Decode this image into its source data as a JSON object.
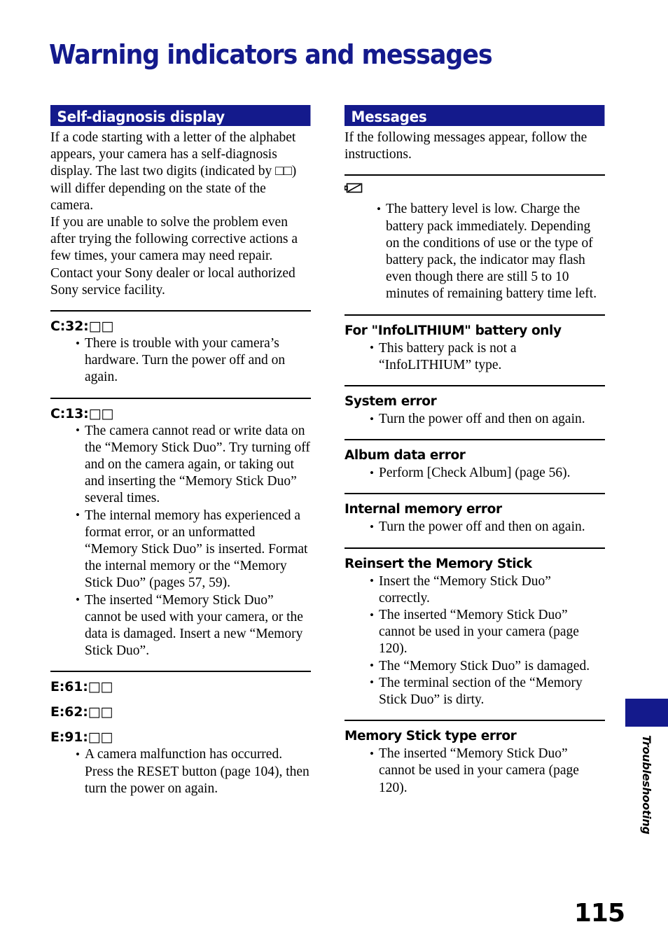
{
  "page": {
    "title": "Warning indicators and messages",
    "number": "115",
    "side_tab_label": "Troubleshooting",
    "accent_color": "#141a8c",
    "rule_color": "#000000"
  },
  "left_column": {
    "header": "Self-diagnosis display",
    "intro": [
      "If a code starting with a letter of the alphabet appears, your camera has a self-diagnosis display. The last two digits (indicated by □□) will differ depending on the state of the camera.",
      "If you are unable to solve the problem even after trying the following corrective actions a few times, your camera may need repair. Contact your Sony dealer or local authorized Sony service facility."
    ],
    "entries": [
      {
        "code": "C:32:□□",
        "bullets": [
          "There is trouble with your camera’s hardware. Turn the power off and on again."
        ]
      },
      {
        "code": "C:13:□□",
        "bullets": [
          "The camera cannot read or write data on the “Memory Stick Duo”. Try turning off and on the camera again, or taking out and inserting the “Memory Stick Duo” several times.",
          "The internal memory has experienced a format error, or an unformatted “Memory Stick Duo” is inserted. Format the internal memory or the “Memory Stick Duo” (pages 57, 59).",
          "The inserted “Memory Stick Duo” cannot be used with your camera, or the data is damaged. Insert a new “Memory Stick Duo”."
        ]
      },
      {
        "codes": [
          "E:61:□□",
          "E:62:□□",
          "E:91:□□"
        ],
        "bullets": [
          "A camera malfunction has occurred. Press the RESET button (page 104), then turn the power on again."
        ]
      }
    ]
  },
  "right_column": {
    "header": "Messages",
    "intro": [
      "If the following messages appear, follow the instructions."
    ],
    "entries": [
      {
        "icon": "low-battery-icon",
        "heading": "",
        "bullets": [
          "The battery level is low. Charge the battery pack immediately. Depending on the conditions of use or the type of battery pack, the indicator may flash even though there are still 5 to 10 minutes of remaining battery time left."
        ]
      },
      {
        "heading": "For \"InfoLITHIUM\" battery only",
        "bullets": [
          "This battery pack is not a “InfoLITHIUM” type."
        ]
      },
      {
        "heading": "System error",
        "bullets": [
          "Turn the power off and then on again."
        ]
      },
      {
        "heading": "Album data error",
        "bullets": [
          "Perform [Check Album] (page 56)."
        ]
      },
      {
        "heading": "Internal memory error",
        "bullets": [
          "Turn the power off and then on again."
        ]
      },
      {
        "heading": "Reinsert the Memory Stick",
        "bullets": [
          "Insert the “Memory Stick Duo” correctly.",
          "The inserted “Memory Stick Duo” cannot be used in your camera (page 120).",
          "The “Memory Stick Duo” is damaged.",
          "The terminal section of the “Memory Stick Duo” is dirty."
        ]
      },
      {
        "heading": "Memory Stick type error",
        "bullets": [
          "The inserted “Memory Stick Duo” cannot be used in your camera (page 120)."
        ]
      }
    ]
  }
}
